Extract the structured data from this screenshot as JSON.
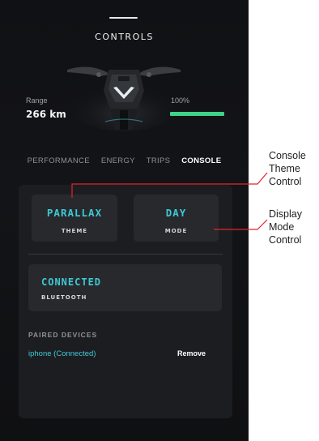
{
  "header": {
    "title": "CONTROLS"
  },
  "stats": {
    "range_label": "Range",
    "range_value": "266 km",
    "battery_percent_label": "100%",
    "battery_level": 1.0
  },
  "tabs": [
    {
      "label": "PERFORMANCE",
      "active": false
    },
    {
      "label": "ENERGY",
      "active": false
    },
    {
      "label": "TRIPS",
      "active": false
    },
    {
      "label": "CONSOLE",
      "active": true
    }
  ],
  "console": {
    "theme": {
      "value": "PARALLAX",
      "label": "THEME"
    },
    "mode": {
      "value": "DAY",
      "label": "MODE"
    },
    "bluetooth": {
      "value": "CONNECTED",
      "label": "BLUETOOTH"
    },
    "paired_devices_heading": "PAIRED DEVICES",
    "devices": [
      {
        "name": "iphone (Connected)",
        "action": "Remove"
      }
    ]
  },
  "annotations": {
    "console_theme": [
      "Console",
      "Theme",
      "Control"
    ],
    "display_mode": [
      "Display",
      "Mode",
      "Control"
    ]
  },
  "colors": {
    "accent": "#3fc8d4",
    "battery": "#3ed28a",
    "background": "#101114",
    "panel": "#1c1d21",
    "tile": "#27292d"
  }
}
